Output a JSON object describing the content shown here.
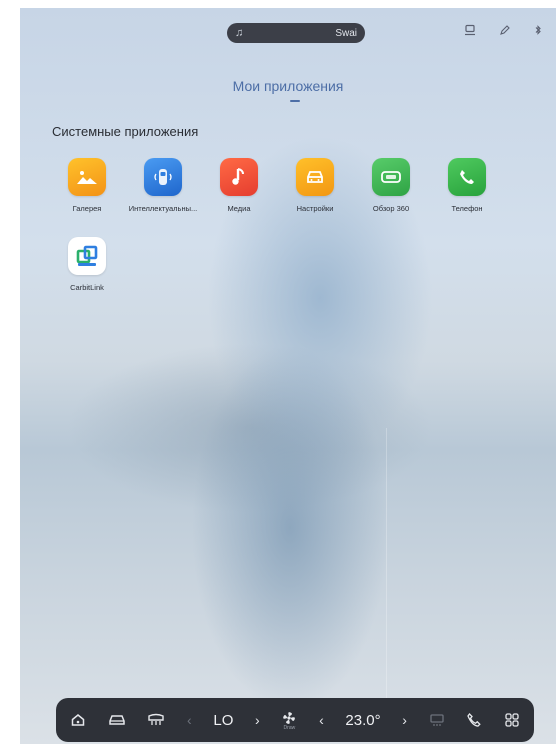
{
  "status_bar": {
    "media_track": "Swai",
    "icons": [
      "music-note-icon",
      "profile-icon",
      "edit-icon",
      "bluetooth-icon"
    ]
  },
  "header": {
    "title": "Мои приложения"
  },
  "section": {
    "title": "Системные приложения"
  },
  "apps": [
    {
      "label": "Галерея",
      "icon": "gallery-icon",
      "color": "#f6a41c"
    },
    {
      "label": "Интеллектуальны...",
      "icon": "smart-car-icon",
      "color": "#2f7fe0"
    },
    {
      "label": "Медиа",
      "icon": "music-note-icon",
      "color": "#ef5138"
    },
    {
      "label": "Настройки",
      "icon": "car-settings-icon",
      "color": "#f5a417"
    },
    {
      "label": "Обзор 360",
      "icon": "camera-360-icon",
      "color": "#36b24a"
    },
    {
      "label": "Телефон",
      "icon": "phone-icon",
      "color": "#2fb142"
    },
    {
      "label": "CarbitLink",
      "icon": "carbitlink-icon",
      "color": "#ffffff"
    }
  ],
  "dock": {
    "temp_left": "LO",
    "fan_sub": "Draw",
    "temp_right": "23.0°",
    "icons": [
      "home-icon",
      "car-icon",
      "defrost-front-icon",
      "fan-icon",
      "defrost-rear-icon",
      "phone-icon",
      "apps-grid-icon"
    ]
  }
}
